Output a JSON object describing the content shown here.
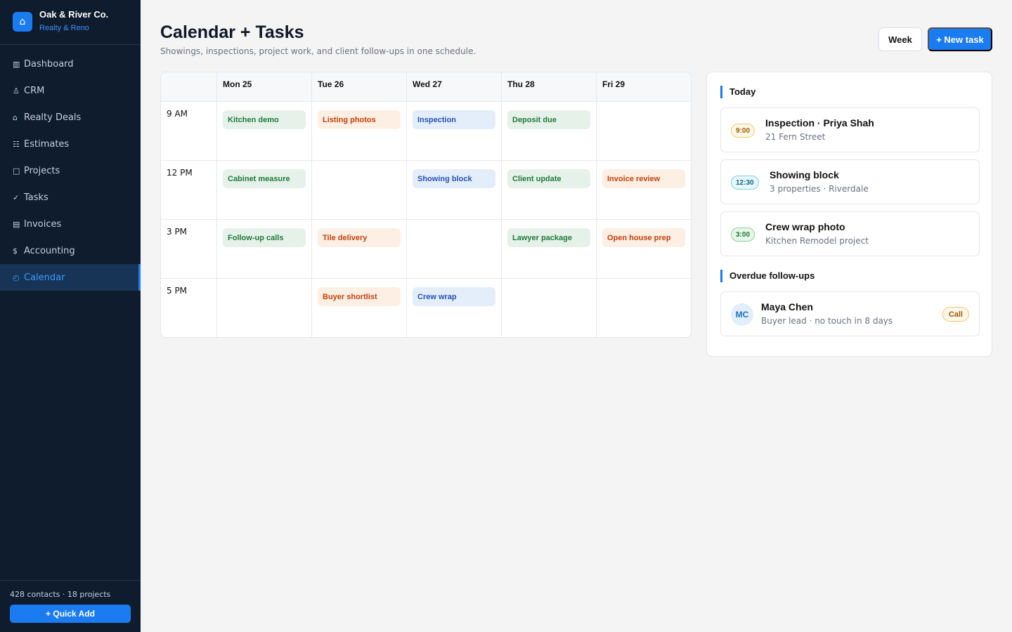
{
  "brand": {
    "name": "Oak & River Co.",
    "subtitle": "Realty & Reno",
    "logo_icon": "⌂"
  },
  "sidebar": {
    "items": [
      {
        "label": "Dashboard",
        "icon": "▥"
      },
      {
        "label": "CRM",
        "icon": "♙"
      },
      {
        "label": "Realty Deals",
        "icon": "⌂"
      },
      {
        "label": "Estimates",
        "icon": "☷"
      },
      {
        "label": "Projects",
        "icon": "□"
      },
      {
        "label": "Tasks",
        "icon": "✓"
      },
      {
        "label": "Invoices",
        "icon": "▤"
      },
      {
        "label": "Accounting",
        "icon": "$"
      },
      {
        "label": "Calendar",
        "icon": "◴",
        "active": true
      }
    ],
    "footer_stats": "428 contacts · 18 projects",
    "quick_add_label": "+ Quick Add"
  },
  "header": {
    "title": "Calendar + Tasks",
    "subtitle": "Showings, inspections, project work, and client follow-ups in one schedule.",
    "week_label": "Week",
    "new_task_label": "+ New task"
  },
  "calendar": {
    "days": [
      "Mon 25",
      "Tue 26",
      "Wed 27",
      "Thu 28",
      "Fri 29"
    ],
    "times": [
      "9 AM",
      "12 PM",
      "3 PM",
      "5 PM"
    ],
    "events": {
      "r0c0": "Kitchen demo",
      "r0c1": "Listing photos",
      "r0c2": "Inspection",
      "r0c3": "Deposit due",
      "r1c0": "Cabinet measure",
      "r1c2": "Showing block",
      "r1c3": "Client update",
      "r1c4": "Invoice review",
      "r2c0": "Follow-up calls",
      "r2c1": "Tile delivery",
      "r2c3": "Lawyer package",
      "r2c4": "Open house prep",
      "r3c1": "Buyer shortlist",
      "r3c2": "Crew wrap"
    },
    "colors": {
      "green": "#1f7a3a",
      "orange": "#c2410c",
      "blue": "#2553b5"
    }
  },
  "panel": {
    "today_title": "Today",
    "today": [
      {
        "time": "9:00",
        "title": "Inspection · Priya Shah",
        "sub": "21 Fern Street"
      },
      {
        "time": "12:30",
        "title": "Showing block",
        "sub": "3 properties · Riverdale"
      },
      {
        "time": "3:00",
        "title": "Crew wrap photo",
        "sub": "Kitchen Remodel project"
      }
    ],
    "overdue_title": "Overdue follow-ups",
    "overdue": [
      {
        "initials": "MC",
        "name": "Maya Chen",
        "sub": "Buyer lead · no touch in 8 days",
        "action": "Call"
      }
    ]
  },
  "accent_color": "#1a7cf0"
}
